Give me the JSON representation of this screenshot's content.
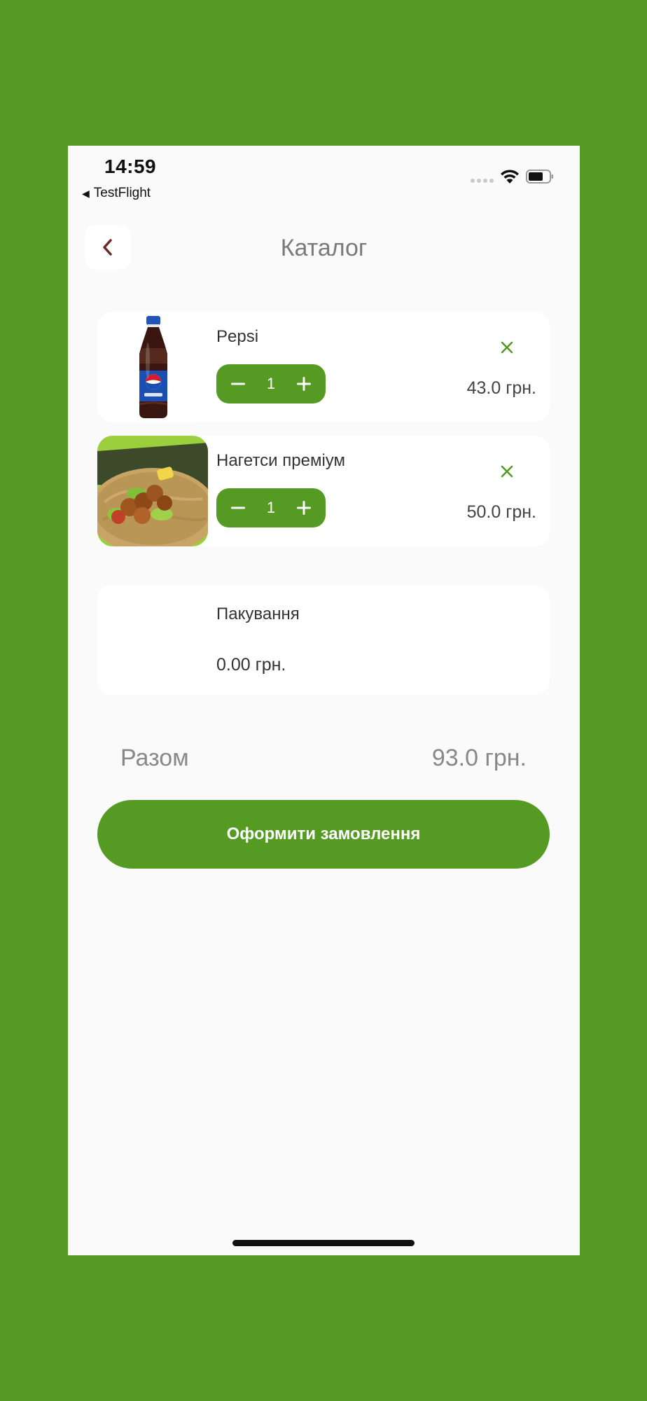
{
  "status_bar": {
    "time": "14:59",
    "back_app": "TestFlight",
    "back_arrow": "◀"
  },
  "header": {
    "title": "Каталог",
    "back_icon": "chevron-left-icon"
  },
  "cart": {
    "items": [
      {
        "name": "Pepsi",
        "quantity": "1",
        "price": "43.0 грн.",
        "minus": "−",
        "plus": "+"
      },
      {
        "name": "Нагетси преміум",
        "quantity": "1",
        "price": "50.0 грн.",
        "minus": "−",
        "plus": "+"
      }
    ],
    "packaging": {
      "name": "Пакування",
      "price": "0.00 грн."
    }
  },
  "summary": {
    "total_label": "Разом",
    "total_value": "93.0 грн."
  },
  "checkout_button": "Оформити замовлення",
  "colors": {
    "accent": "#559a22",
    "background": "#fafafa",
    "card": "#ffffff",
    "back_chevron": "#6b2a2a"
  }
}
